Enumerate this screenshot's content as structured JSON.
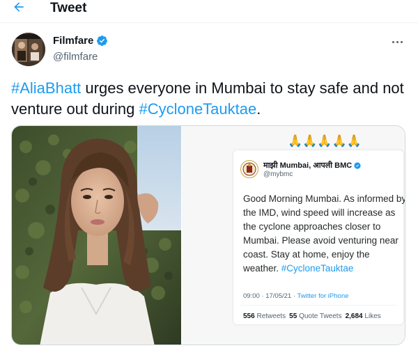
{
  "header": {
    "title": "Tweet",
    "back_icon": "arrow-left-icon"
  },
  "author": {
    "display_name": "Filmfare",
    "handle": "@filmfare",
    "verified": true,
    "more_icon": "more-horizontal-icon"
  },
  "tweet": {
    "hashtag_1": "#AliaBhatt",
    "text_1": " urges everyone in Mumbai to stay safe and not venture out during ",
    "hashtag_2": "#CycloneTauktae",
    "text_2": "."
  },
  "media": {
    "embedded_tweet": {
      "emoji": "🙏🙏🙏🙏🙏",
      "display_name": "माझी Mumbai, आपली BMC",
      "handle": "@mybmc",
      "verified": true,
      "text": "Good Morning Mumbai. As informed by the IMD, wind speed will increase as the cyclone approaches closer to Mumbai. Please avoid venturing near coast. Stay at home, enjoy the weather. ",
      "hashtag": "#CycloneTauktae",
      "timestamp": "09:00 · 17/05/21 · ",
      "source": "Twitter for iPhone",
      "retweets_count": "556",
      "retweets_label": "Retweets",
      "quote_count": "55",
      "quote_label": "Quote Tweets",
      "likes_count": "2,684",
      "likes_label": "Likes"
    }
  },
  "colors": {
    "accent": "#1d9bf0",
    "text_primary": "#0f1419",
    "text_secondary": "#536471",
    "border": "#cfd9de"
  }
}
